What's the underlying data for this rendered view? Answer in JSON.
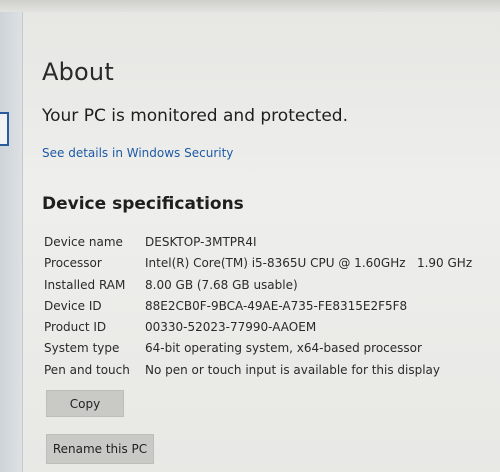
{
  "page": {
    "title": "About",
    "protection_status": "Your PC is monitored and protected.",
    "security_link": "See details in Windows Security"
  },
  "device_specs": {
    "heading": "Device specifications",
    "rows": [
      {
        "label": "Device name",
        "value": "DESKTOP-3MTPR4I"
      },
      {
        "label": "Processor",
        "value": "Intel(R) Core(TM) i5-8365U CPU @ 1.60GHz   1.90 GHz"
      },
      {
        "label": "Installed RAM",
        "value": "8.00 GB (7.68 GB usable)"
      },
      {
        "label": "Device ID",
        "value": "88E2CB0F-9BCA-49AE-A735-FE8315E2F5F8"
      },
      {
        "label": "Product ID",
        "value": "00330-52023-77990-AAOEM"
      },
      {
        "label": "System type",
        "value": "64-bit operating system, x64-based processor"
      },
      {
        "label": "Pen and touch",
        "value": "No pen or touch input is available for this display"
      }
    ]
  },
  "buttons": {
    "copy": "Copy",
    "rename": "Rename this PC"
  },
  "colors": {
    "link": "#1d5aa6",
    "button_bg": "#c9c9c6",
    "background": "#eeeeec"
  }
}
